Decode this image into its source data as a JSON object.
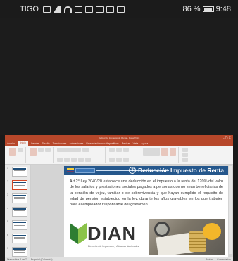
{
  "status_bar": {
    "carrier": "TIGO",
    "battery": "86 %",
    "time": "9:48"
  },
  "powerpoint": {
    "window_title": "Deducción Impuesto de Renta - PowerPoint",
    "tabs": [
      "Archivo",
      "Inicio",
      "Insertar",
      "Diseño",
      "Transiciones",
      "Animaciones",
      "Presentación con diapositivas",
      "Revisar",
      "Vista",
      "Ayuda"
    ],
    "active_tab": "Inicio",
    "thumbnail_numbers": [
      "1",
      "2",
      "3",
      "4",
      "5",
      "6",
      "7"
    ],
    "slide": {
      "title": "Deducción Impuesto de Renta",
      "body": "Art 2° Ley 2040/20 establece una deducción en el impuesto a la renta del 120% del valor de los salarios y prestaciones sociales pagados a personas que no sean beneficiarias de la pensión de vejez, familiar o de sobrevivencia y que hayan cumplido el requisito de edad de pensión establecido en la ley, durante los años gravables en los que trabajen para el empleador responsable del gravamen.",
      "logo_text": "DIAN",
      "logo_subtitle": "Dirección de Impuestos y Aduanas Nacionales"
    },
    "status": {
      "slide_info": "Diapositiva 2 de 7",
      "language": "Español (Colombia)",
      "notes": "Notas",
      "comments": "Comentarios"
    }
  }
}
